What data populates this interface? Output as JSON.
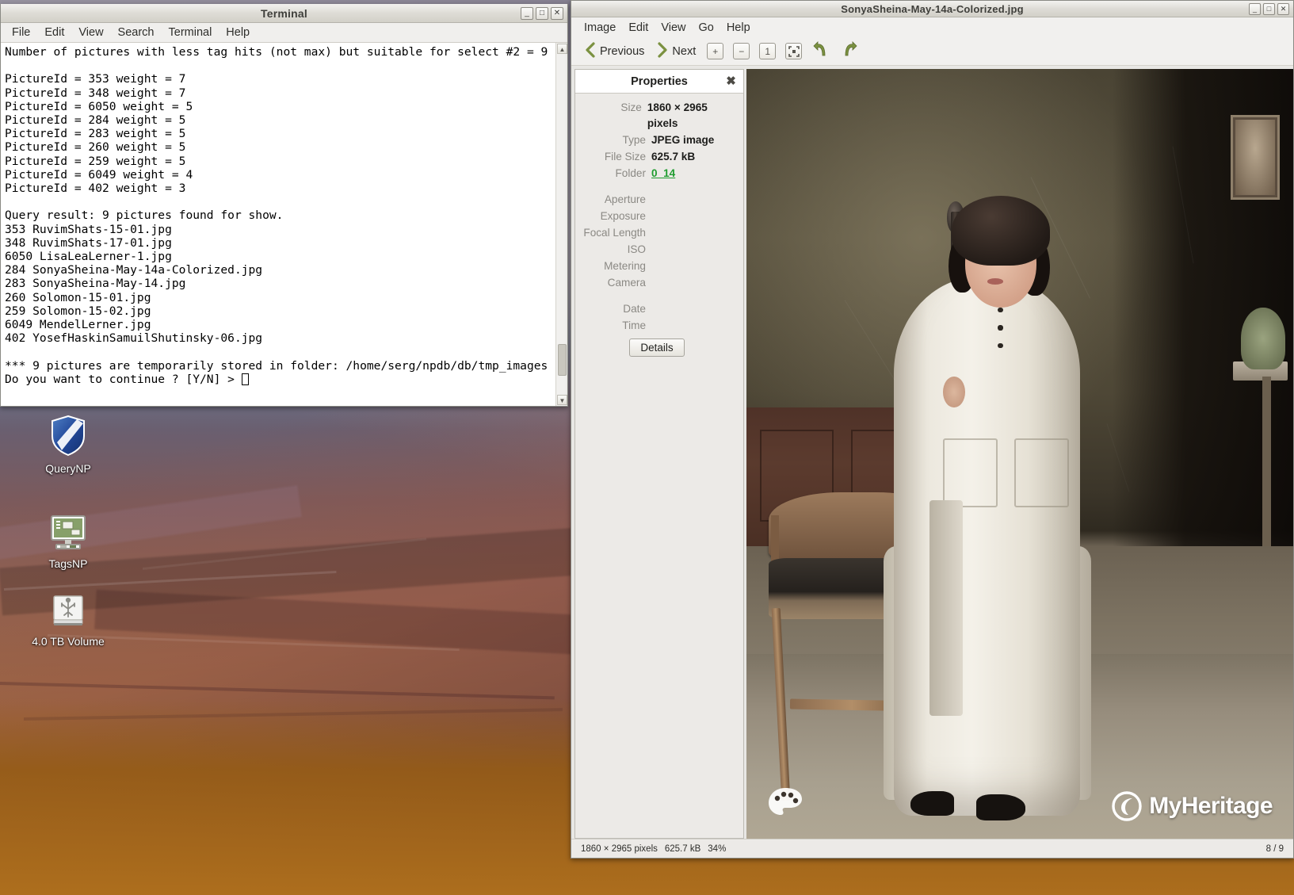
{
  "desktop": {
    "icons": [
      {
        "label": "QueryNP",
        "icon": "shield-icon"
      },
      {
        "label": "TagsNP",
        "icon": "monitor-icon"
      },
      {
        "label": "4.0 TB Volume",
        "icon": "drive-icon"
      }
    ]
  },
  "terminal": {
    "title": "Terminal",
    "menu": [
      "File",
      "Edit",
      "View",
      "Search",
      "Terminal",
      "Help"
    ],
    "window_buttons": {
      "minimize": "_",
      "maximize": "□",
      "close": "✕"
    },
    "output": "Number of pictures with less tag hits (not max) but suitable for select #2 = 9\n\nPictureId = 353 weight = 7\nPictureId = 348 weight = 7\nPictureId = 6050 weight = 5\nPictureId = 284 weight = 5\nPictureId = 283 weight = 5\nPictureId = 260 weight = 5\nPictureId = 259 weight = 5\nPictureId = 6049 weight = 4\nPictureId = 402 weight = 3\n\nQuery result: 9 pictures found for show.\n353 RuvimShats-15-01.jpg\n348 RuvimShats-17-01.jpg\n6050 LisaLeaLerner-1.jpg\n284 SonyaSheina-May-14a-Colorized.jpg\n283 SonyaSheina-May-14.jpg\n260 Solomon-15-01.jpg\n259 Solomon-15-02.jpg\n6049 MendelLerner.jpg\n402 YosefHaskinSamuilShutinsky-06.jpg\n\n*** 9 pictures are temporarily stored in folder: /home/serg/npdb/db/tmp_images\n",
    "prompt": "Do you want to continue ? [Y/N] > ",
    "scrollbar": {
      "up_arrow": "▲",
      "down_arrow": "▼"
    }
  },
  "viewer": {
    "title": "SonyaSheina-May-14a-Colorized.jpg",
    "window_buttons": {
      "minimize": "_",
      "maximize": "□",
      "close": "✕"
    },
    "menu": [
      "Image",
      "Edit",
      "View",
      "Go",
      "Help"
    ],
    "toolbar": {
      "previous": "Previous",
      "next": "Next",
      "zoom_in": "+",
      "zoom_out": "−",
      "normal_size": "1",
      "best_fit": "⛶",
      "rotate_left": "↺",
      "rotate_right": "↻"
    },
    "properties": {
      "header": "Properties",
      "close": "✖",
      "rows": [
        {
          "label": "Size",
          "value": "1860 × 2965 pixels",
          "link": false
        },
        {
          "label": "Type",
          "value": "JPEG image",
          "link": false
        },
        {
          "label": "File Size",
          "value": "625.7 kB",
          "link": false
        },
        {
          "label": "Folder",
          "value": "0_14",
          "link": true
        }
      ],
      "exif": [
        "Aperture",
        "Exposure",
        "Focal Length",
        "ISO",
        "Metering",
        "Camera"
      ],
      "datetime": [
        "Date",
        "Time"
      ],
      "details_button": "Details"
    },
    "statusbar": {
      "dimensions": "1860 × 2965 pixels",
      "filesize": "625.7 kB",
      "zoom": "34%",
      "position": "8 / 9"
    },
    "image_watermarks": {
      "palette": "palette-icon",
      "brand": "MyHeritage"
    }
  }
}
